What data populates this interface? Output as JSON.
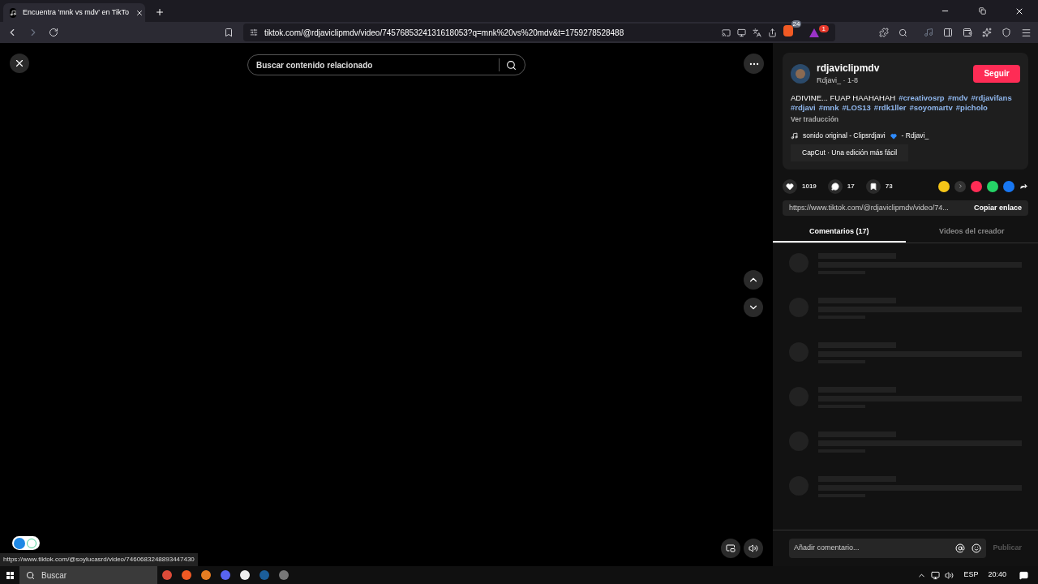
{
  "browser": {
    "tab": {
      "title": "Encuentra 'mnk vs mdv' en TikTo",
      "selected": true
    },
    "url": "tiktok.com/@rdjaviclipmdv/video/7457685324131618053?q=mnk%20vs%20mdv&t=1759278528488",
    "brave_count": "24",
    "rewards_count": "1"
  },
  "player": {
    "search_placeholder": "Buscar contenido relacionado"
  },
  "post": {
    "username": "rdjaviclipmdv",
    "meta": "Rdjavi_ · 1-8",
    "follow": "Seguir",
    "caption": "ADIVINE... FUAP HAAHAHAH",
    "hashtags": [
      "#creativosrp",
      "#mdv",
      "#rdjavifans",
      "#rdjavi",
      "#mnk",
      "#LOS13",
      "#rdk1ller",
      "#soyomartv",
      "#picholo"
    ],
    "translate": "Ver traducción",
    "sound": "sonido original - Clipsrdjavi",
    "sound_author": "- Rdjavi_",
    "capcut": "CapCut · Una edición más fácil"
  },
  "stats": {
    "likes": "1019",
    "comments": "17",
    "saves": "73"
  },
  "link": {
    "url": "https://www.tiktok.com/@rdjaviclipmdv/video/74...",
    "copy": "Copiar enlace"
  },
  "tabs": [
    {
      "label": "Comentarios (17)",
      "selected": true
    },
    {
      "label": "Videos del creador",
      "selected": false
    }
  ],
  "comment_box": {
    "placeholder": "Añadir comentario...",
    "post": "Publicar"
  },
  "status_link": "https://www.tiktok.com/@soylucasrd/video/7460683248893447430",
  "taskbar": {
    "search": "Buscar",
    "lang": "ESP",
    "time": "20:40"
  }
}
